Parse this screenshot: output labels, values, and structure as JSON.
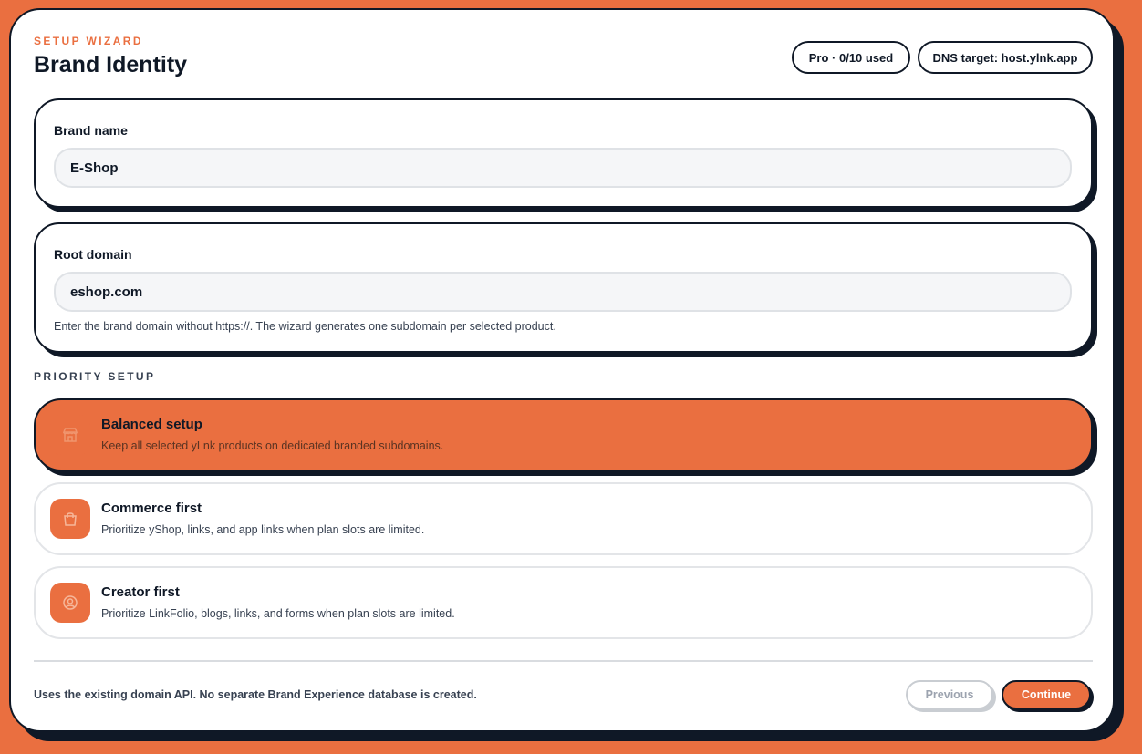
{
  "header": {
    "eyebrow": "SETUP WIZARD",
    "title": "Brand Identity",
    "plan_pill": "Pro · 0/10 used",
    "dns_pill": "DNS target: host.ylnk.app"
  },
  "fields": {
    "brand_name": {
      "label": "Brand name",
      "value": "E-Shop"
    },
    "root_domain": {
      "label": "Root domain",
      "value": "eshop.com",
      "help": "Enter the brand domain without https://. The wizard generates one subdomain per selected product."
    }
  },
  "priority": {
    "section_label": "PRIORITY SETUP",
    "options": [
      {
        "title": "Balanced setup",
        "description": "Keep all selected yLnk products on dedicated branded subdomains.",
        "icon": "storefront-icon",
        "selected": true
      },
      {
        "title": "Commerce first",
        "description": "Prioritize yShop, links, and app links when plan slots are limited.",
        "icon": "shopping-bag-icon",
        "selected": false
      },
      {
        "title": "Creator first",
        "description": "Prioritize LinkFolio, blogs, links, and forms when plan slots are limited.",
        "icon": "user-circle-icon",
        "selected": false
      }
    ]
  },
  "footer": {
    "note": "Uses the existing domain API. No separate Brand Experience database is created.",
    "previous_label": "Previous",
    "continue_label": "Continue"
  },
  "colors": {
    "accent": "#ea6f40",
    "ink": "#0f1826",
    "muted": "#374151"
  }
}
